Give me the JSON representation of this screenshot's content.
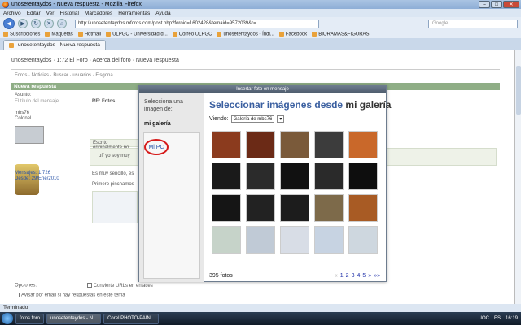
{
  "window": {
    "title": "unosetentaydos - Nueva respuesta - Mozilla Firefox"
  },
  "menu": [
    "Archivo",
    "Editar",
    "Ver",
    "Historial",
    "Marcadores",
    "Herramientas",
    "Ayuda"
  ],
  "nav": {
    "url": "http://unosetentaydos.mforos.com/post.php?foroid=1602428&temaid=9572039&r=",
    "search_placeholder": "Google"
  },
  "bookmarks": [
    "Suscripciones",
    "Maquetas",
    "Hotmail",
    "ULPGC - Universidad d...",
    "Correo ULPGC",
    "unosetentaydos - Índi...",
    "Facebook",
    "BIORAMAS&FIGURAS"
  ],
  "tab": {
    "label": "unosetentaydos - Nueva respuesta"
  },
  "forum": {
    "header": "unosetentaydos · 1:72 El Foro · Acerca del foro · Nueva respuesta",
    "crumbs": "unosetentaydos · 1:72 El Foro · Acerca del foro · Nueva respuesta",
    "nav": "Foros · Noticias · Buscar · usuarios · Fisgona",
    "section_title": "Nueva respuesta",
    "asunto_label": "Asunto:",
    "asunto_value": "El título del mensaje",
    "re_label": "RE: Fotos",
    "user": "mbs76",
    "rank": "Colonel",
    "mensajes": "Mensajes: 1,726",
    "desde": "Desde: 29/Ene/2010",
    "quote_label": "Escrito originalmente po",
    "quote_text": "uff yo soy muy",
    "text1": "Es muy sencillo, es",
    "text2": "Primero pinchamos",
    "opciones_label": "Opciones:",
    "opt1": "Convierte URLs en enlaces",
    "opt2": "Avisar por email si hay respuestas en este tema"
  },
  "modal": {
    "title": "Insertar foto en mensaje",
    "side_heading": "Selecciona una imagen de:",
    "side_items": [
      "mi galería",
      "Mi PC"
    ],
    "heading_a": "Seleccionar imágenes desde ",
    "heading_b": "mi galería",
    "viewing_label": "Viendo:",
    "viewing_value": "Galería de mbs76",
    "photo_count": "395 fotos",
    "pages": [
      "1",
      "2",
      "3",
      "4",
      "5",
      "»",
      "»»"
    ],
    "thumbs": [
      {
        "color": "#8b3b1e"
      },
      {
        "color": "#6b2a16"
      },
      {
        "color": "#7a5a3a"
      },
      {
        "color": "#3c3c3c"
      },
      {
        "color": "#c9682a"
      },
      {
        "color": "#1a1a1a"
      },
      {
        "color": "#2b2b2b"
      },
      {
        "color": "#111111"
      },
      {
        "color": "#2a2a2a"
      },
      {
        "color": "#0e0e0e"
      },
      {
        "color": "#151515"
      },
      {
        "color": "#222222"
      },
      {
        "color": "#1c1c1c"
      },
      {
        "color": "#7d6a4a"
      },
      {
        "color": "#a85b24"
      },
      {
        "color": "#c6d3c9"
      },
      {
        "color": "#c0cad6"
      },
      {
        "color": "#d8dde6"
      },
      {
        "color": "#c7d3e2"
      },
      {
        "color": "#ced7df"
      }
    ]
  },
  "status": "Terminado",
  "taskbar": [
    "fotos foro",
    "unosetentaydos - N...",
    "Corel PHOTO-PAIN..."
  ],
  "tray": {
    "lang": "ES",
    "time": "16:19",
    "extra": "UOC"
  }
}
